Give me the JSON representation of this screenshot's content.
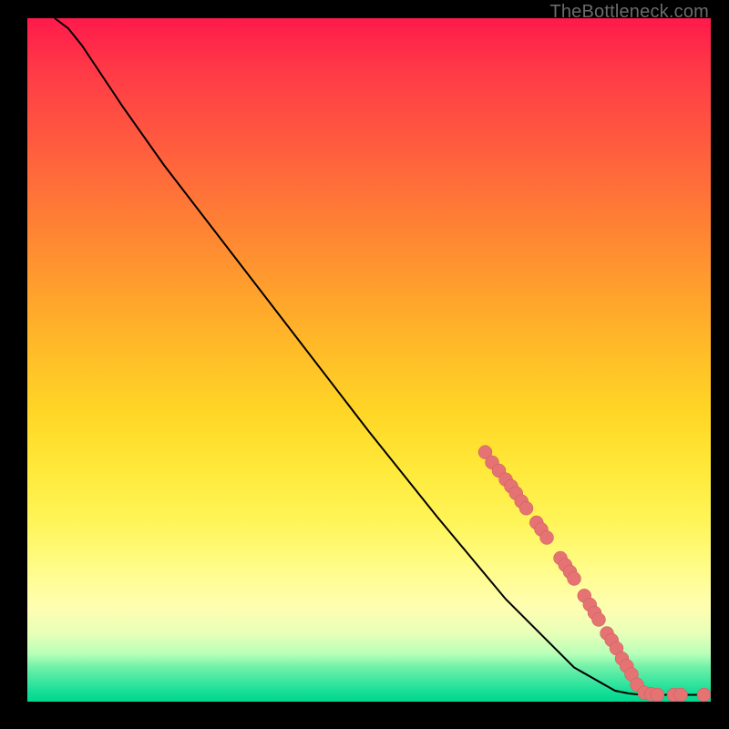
{
  "watermark": "TheBottleneck.com",
  "colors": {
    "point_fill": "#e57373",
    "point_stroke": "#c95b5b",
    "line": "#000000"
  },
  "chart_data": {
    "type": "line",
    "title": "",
    "xlabel": "",
    "ylabel": "",
    "xlim": [
      0,
      100
    ],
    "ylim": [
      0,
      100
    ],
    "grid": false,
    "legend": false,
    "series": [
      {
        "name": "curve",
        "x": [
          4,
          6,
          8,
          10,
          14,
          20,
          30,
          40,
          50,
          60,
          70,
          80,
          86,
          88,
          90,
          92,
          94,
          96,
          99
        ],
        "y": [
          100,
          98.5,
          96,
          93,
          87,
          78.5,
          65.5,
          52.5,
          39.5,
          27,
          15,
          5,
          1.6,
          1.2,
          1.0,
          1.0,
          1.0,
          1.0,
          1.0
        ]
      }
    ],
    "points": [
      {
        "x": 67,
        "y": 36.5
      },
      {
        "x": 68,
        "y": 35.0
      },
      {
        "x": 69,
        "y": 33.8
      },
      {
        "x": 70,
        "y": 32.5
      },
      {
        "x": 70.8,
        "y": 31.5
      },
      {
        "x": 71.5,
        "y": 30.5
      },
      {
        "x": 72.3,
        "y": 29.3
      },
      {
        "x": 73,
        "y": 28.3
      },
      {
        "x": 74.5,
        "y": 26.2
      },
      {
        "x": 75.2,
        "y": 25.2
      },
      {
        "x": 76,
        "y": 24.0
      },
      {
        "x": 78,
        "y": 21.0
      },
      {
        "x": 78.7,
        "y": 20.0
      },
      {
        "x": 79.4,
        "y": 19.0
      },
      {
        "x": 80,
        "y": 18.0
      },
      {
        "x": 81.5,
        "y": 15.5
      },
      {
        "x": 82.3,
        "y": 14.2
      },
      {
        "x": 83,
        "y": 13.0
      },
      {
        "x": 83.6,
        "y": 12.0
      },
      {
        "x": 84.8,
        "y": 10.0
      },
      {
        "x": 85.5,
        "y": 9.0
      },
      {
        "x": 86.2,
        "y": 7.8
      },
      {
        "x": 87,
        "y": 6.3
      },
      {
        "x": 87.7,
        "y": 5.2
      },
      {
        "x": 88.4,
        "y": 4.0
      },
      {
        "x": 89.2,
        "y": 2.5
      },
      {
        "x": 90.3,
        "y": 1.3
      },
      {
        "x": 91.3,
        "y": 1.1
      },
      {
        "x": 92.2,
        "y": 1.0
      },
      {
        "x": 94.6,
        "y": 1.0
      },
      {
        "x": 95.6,
        "y": 1.0
      },
      {
        "x": 99.0,
        "y": 1.0
      }
    ],
    "point_radius": 1.0
  }
}
